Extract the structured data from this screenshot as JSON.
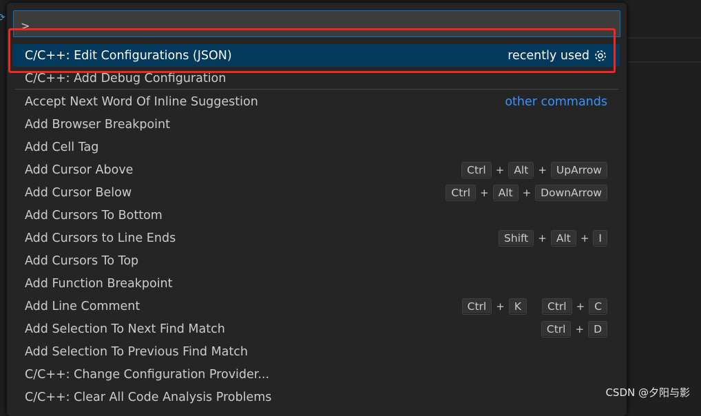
{
  "input": {
    "value": ">"
  },
  "selected": {
    "label": "C/C++: Edit Configurations (JSON)",
    "hint": "recently used",
    "icon": "gear-icon"
  },
  "recent": [
    {
      "label": "C/C++: Add Debug Configuration"
    }
  ],
  "other_label": "other commands",
  "items": [
    {
      "label": "Accept Next Word Of Inline Suggestion",
      "keys": []
    },
    {
      "label": "Add Browser Breakpoint",
      "keys": []
    },
    {
      "label": "Add Cell Tag",
      "keys": []
    },
    {
      "label": "Add Cursor Above",
      "keys": [
        [
          "Ctrl",
          "Alt",
          "UpArrow"
        ]
      ]
    },
    {
      "label": "Add Cursor Below",
      "keys": [
        [
          "Ctrl",
          "Alt",
          "DownArrow"
        ]
      ]
    },
    {
      "label": "Add Cursors To Bottom",
      "keys": []
    },
    {
      "label": "Add Cursors to Line Ends",
      "keys": [
        [
          "Shift",
          "Alt",
          "I"
        ]
      ]
    },
    {
      "label": "Add Cursors To Top",
      "keys": []
    },
    {
      "label": "Add Function Breakpoint",
      "keys": []
    },
    {
      "label": "Add Line Comment",
      "keys": [
        [
          "Ctrl",
          "K"
        ],
        [
          "Ctrl",
          "C"
        ]
      ]
    },
    {
      "label": "Add Selection To Next Find Match",
      "keys": [
        [
          "Ctrl",
          "D"
        ]
      ]
    },
    {
      "label": "Add Selection To Previous Find Match",
      "keys": []
    },
    {
      "label": "C/C++: Change Configuration Provider...",
      "keys": []
    },
    {
      "label": "C/C++: Clear All Code Analysis Problems",
      "keys": []
    }
  ],
  "watermark": "CSDN @夕阳与影",
  "colors": {
    "accent": "#0078d4",
    "selection": "#04395e",
    "highlight_box": "#ee2a1e",
    "link": "#3794ff"
  }
}
